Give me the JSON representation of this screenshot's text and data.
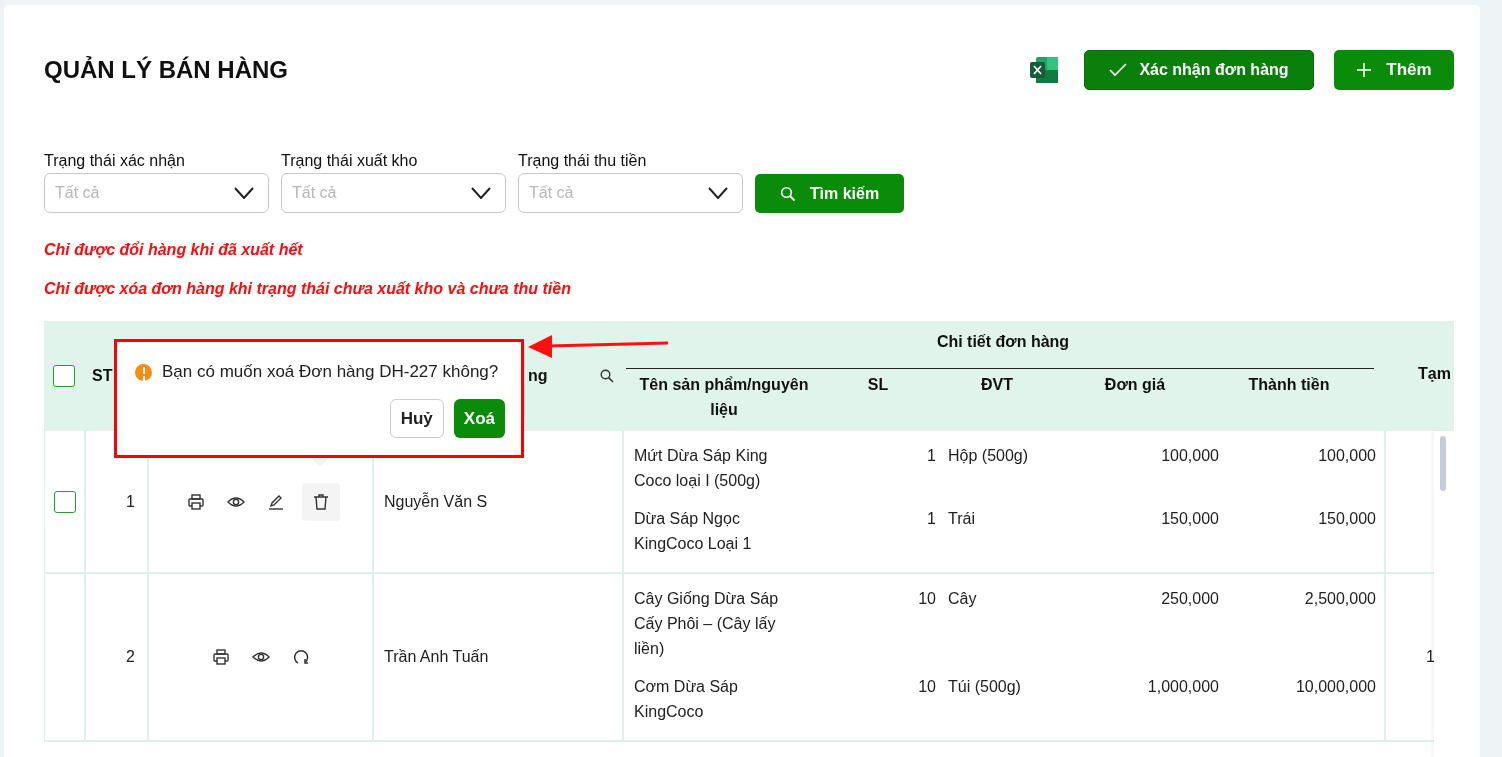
{
  "page": {
    "title": "QUẢN LÝ BÁN HÀNG"
  },
  "toolbar": {
    "export": {
      "kind": "excel"
    },
    "buttons": [
      {
        "kind": "confirm",
        "label": "Xác nhận đơn hàng"
      },
      {
        "kind": "add",
        "label": "Thêm"
      }
    ]
  },
  "filters": [
    {
      "label": "Trạng thái xác nhận",
      "placeholder": "Tất cả"
    },
    {
      "label": "Trạng thái xuất kho",
      "placeholder": "Tất cả"
    },
    {
      "label": "Trạng thái thu tiền",
      "placeholder": "Tất cả"
    }
  ],
  "search_button": {
    "label": "Tìm kiếm"
  },
  "notes": [
    "Chỉ được đổi hàng khi đã xuất hết",
    "Chỉ được xóa đơn hàng khi trạng thái chưa xuất kho và chưa thu tiền"
  ],
  "table": {
    "header": {
      "checked": false,
      "stt": "ST",
      "customer": "ng",
      "detail_group": "Chi tiết đơn hàng",
      "detail_columns": [
        "Tên sản phẩm/nguyên liệu",
        "SL",
        "ĐVT",
        "Đơn giá",
        "Thành tiền"
      ],
      "last": "Tạm"
    },
    "rows": [
      {
        "selectable": true,
        "checked": false,
        "stt": "1",
        "actions": [
          {
            "kind": "print",
            "active": false
          },
          {
            "kind": "view",
            "active": false
          },
          {
            "kind": "edit",
            "active": false
          },
          {
            "kind": "delete",
            "active": true
          }
        ],
        "customer": "Nguyễn Văn S",
        "items": [
          {
            "name": "Mứt Dừa Sáp King Coco loại I (500g)",
            "qty": "1",
            "unit": "Hộp (500g)",
            "price": "100,000",
            "total": "100,000"
          },
          {
            "name": "Dừa Sáp Ngọc KingCoco Loại 1",
            "qty": "1",
            "unit": "Trái",
            "price": "150,000",
            "total": "150,000"
          }
        ]
      },
      {
        "selectable": false,
        "stt": "2",
        "actions": [
          {
            "kind": "print",
            "active": false
          },
          {
            "kind": "view",
            "active": false
          },
          {
            "kind": "restore",
            "active": false
          }
        ],
        "customer": "Trần Anh Tuấn",
        "items": [
          {
            "name": "Cây Giống Dừa Sáp Cấy Phôi – (Cây lấy liền)",
            "qty": "10",
            "unit": "Cây",
            "price": "250,000",
            "total": "2,500,000"
          },
          {
            "name": "Cơm Dừa Sáp KingCoco",
            "qty": "10",
            "unit": "Túi (500g)",
            "price": "1,000,000",
            "total": "10,000,000"
          }
        ],
        "last": "1"
      }
    ]
  },
  "popconfirm": {
    "message": "Bạn có muốn xoá Đơn hàng DH-227 không?",
    "cancel": "Huỷ",
    "ok": "Xoá"
  }
}
